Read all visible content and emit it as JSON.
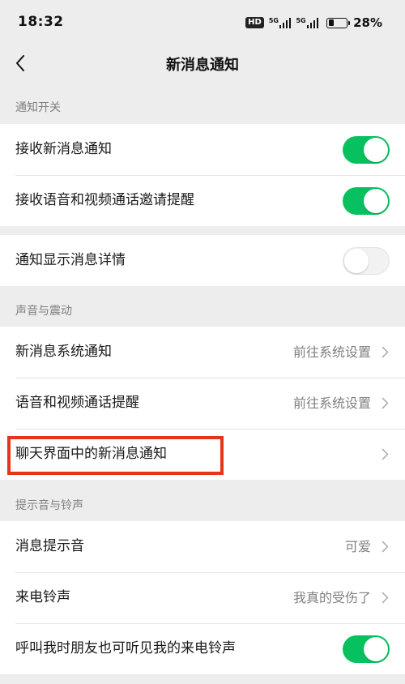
{
  "status_bar": {
    "time": "18:32",
    "hd_badge": "HD",
    "network_1": "5G",
    "network_2": "5G",
    "battery_percent": "28%",
    "battery_level": 0.28
  },
  "nav": {
    "back_icon": "chevron-left-icon",
    "title": "新消息通知"
  },
  "sections": {
    "notification_switch": {
      "header": "通知开关",
      "receive_new_message": {
        "label": "接收新消息通知",
        "toggle": true
      },
      "receive_call_invite": {
        "label": "接收语音和视频通话邀请提醒",
        "toggle": true
      },
      "show_details": {
        "label": "通知显示消息详情",
        "toggle": false
      }
    },
    "sound_vibration": {
      "header": "声音与震动",
      "system_notification": {
        "label": "新消息系统通知",
        "value": "前往系统设置"
      },
      "call_reminder": {
        "label": "语音和视频通话提醒",
        "value": "前往系统设置"
      },
      "in_chat_notification": {
        "label": "聊天界面中的新消息通知",
        "value": ""
      }
    },
    "tones_ringtones": {
      "header": "提示音与铃声",
      "message_tone": {
        "label": "消息提示音",
        "value": "可爱"
      },
      "ringtone": {
        "label": "来电铃声",
        "value": "我真的受伤了"
      },
      "friend_hears_ringtone": {
        "label": "呼叫我时朋友也可听见我的来电铃声",
        "toggle": true
      }
    }
  },
  "colors": {
    "background": "#ededed",
    "toggle_on": "#07c160",
    "toggle_off": "#f2f2f2",
    "highlight": "#e9341c",
    "secondary_text": "#808080"
  }
}
